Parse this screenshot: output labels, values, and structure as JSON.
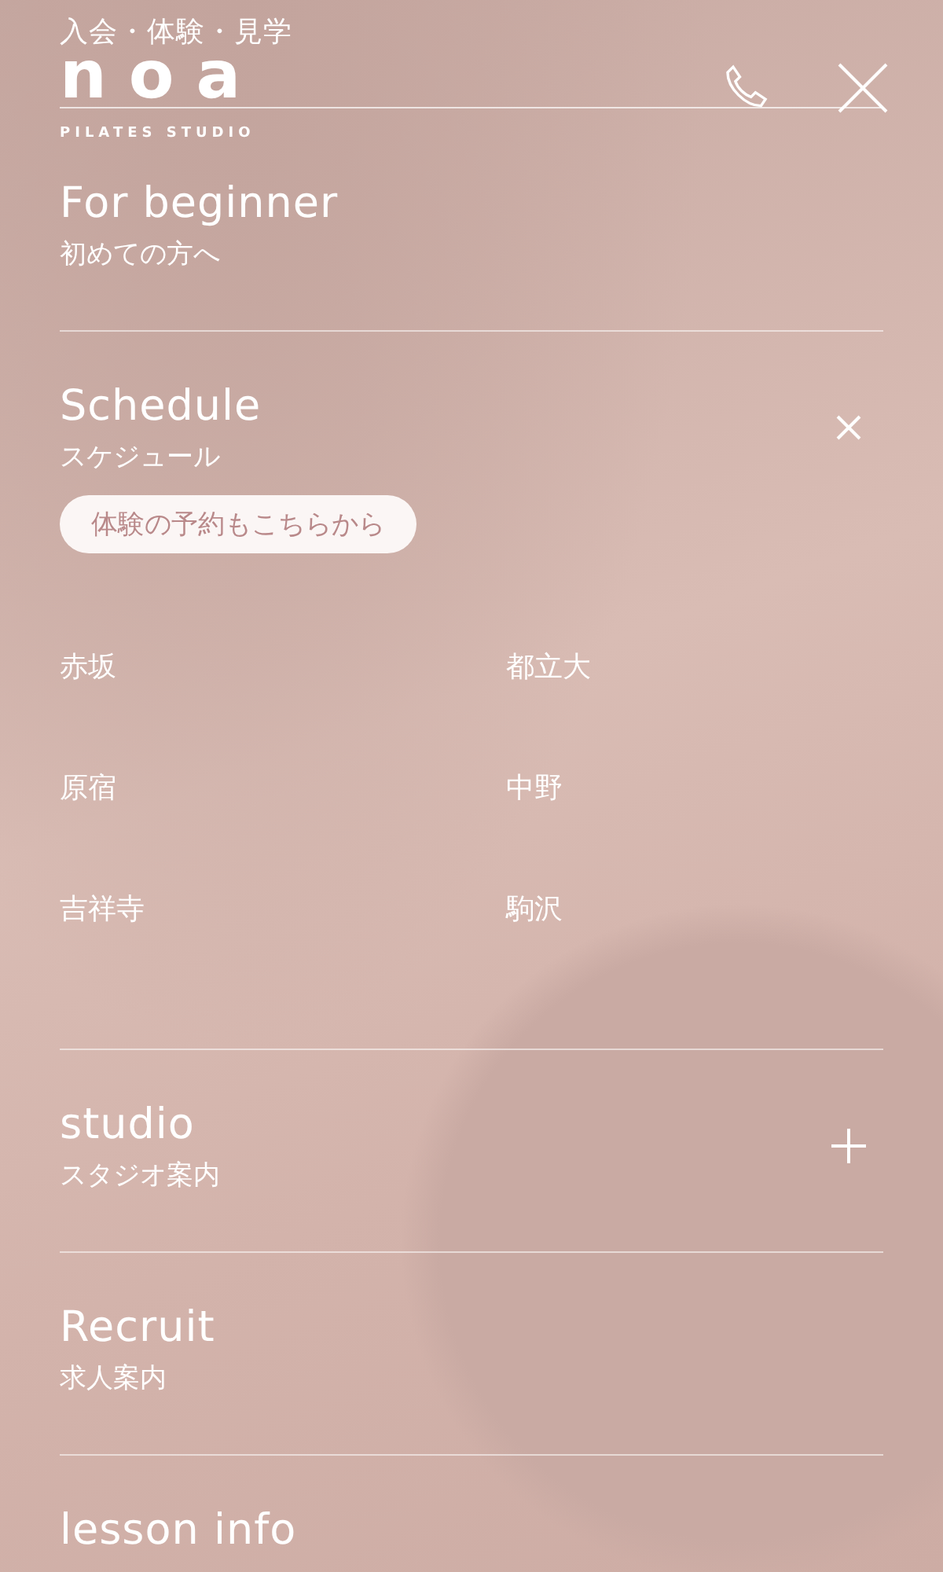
{
  "header": {
    "tagline": "入会・体験・見学",
    "logo": "noa",
    "logo_sub": "PILATES STUDIO"
  },
  "menu": [
    {
      "title": "For beginner",
      "subtitle": "初めての方へ"
    },
    {
      "title": "Schedule",
      "subtitle": "スケジュール",
      "expanded": true,
      "button": "体験の予約もこちらから",
      "locations": [
        "赤坂",
        "都立大",
        "原宿",
        "中野",
        "吉祥寺",
        "駒沢"
      ]
    },
    {
      "title": "studio",
      "subtitle": "スタジオ案内",
      "expanded": false
    },
    {
      "title": "Recruit",
      "subtitle": "求人案内"
    },
    {
      "title": "lesson info"
    }
  ]
}
